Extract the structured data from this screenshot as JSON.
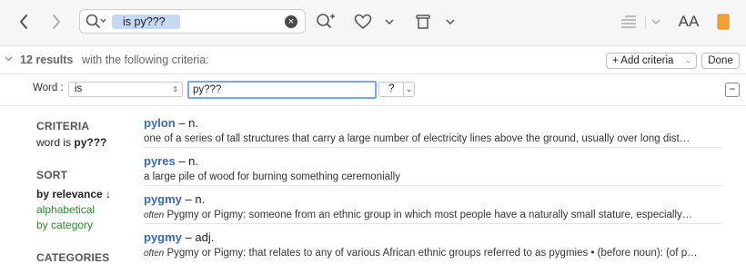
{
  "toolbar": {
    "search_token": "is py???",
    "clear_glyph": "×",
    "icons": [
      "back-icon",
      "forward-icon",
      "search-icon",
      "clear-icon",
      "zoom-in-icon",
      "heart-icon",
      "chevron-down-icon",
      "trash-icon",
      "indent-icon",
      "text-size-icon",
      "bookmark-icon"
    ],
    "text_size_label": "AA",
    "bookmark_color": "#f0a23a"
  },
  "results": {
    "count_label": "12 results",
    "criteria_text": "with the following criteria:",
    "add_criteria_label": "+ Add criteria",
    "done_label": "Done"
  },
  "filter": {
    "field_label": "Word :",
    "operator_value": "is",
    "query_value": "py???",
    "wildcard_value": "?",
    "remove_glyph": "−"
  },
  "sidebar": {
    "criteria_heading": "CRITERIA",
    "criteria_prefix": "word is",
    "criteria_value": "py???",
    "sort_heading": "SORT",
    "sort_selected": "by relevance ↓",
    "sort_alpha": "alphabetical",
    "sort_category": "by category",
    "categories_heading": "CATEGORIES"
  },
  "entries": [
    {
      "word": "pylon",
      "pos": "– n.",
      "def_pre": "",
      "def": "one of a series of tall structures that carry a large number of electricity lines above the ground, usually over long dist…"
    },
    {
      "word": "pyres",
      "pos": "– n.",
      "def_pre": "",
      "def": "a large pile of wood for burning something ceremonially"
    },
    {
      "word": "pygmy",
      "pos": "– n.",
      "def_pre": "often",
      "def": "Pygmy or Pigmy: someone from an ethnic group in which most people have a naturally small stature, especially…"
    },
    {
      "word": "pygmy",
      "pos": "– adj.",
      "def_pre": "often",
      "def": "Pygmy or Pigmy: that relates to any of various African ethnic groups referred to as pygmies • (before noun): (of p…"
    }
  ]
}
